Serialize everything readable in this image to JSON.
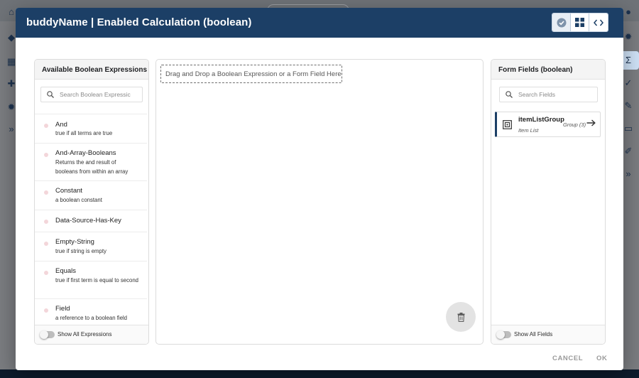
{
  "dialog": {
    "title": "buddyName | Enabled Calculation (boolean)"
  },
  "expressions_panel": {
    "header": "Available Boolean Expressions",
    "search_placeholder": "Search Boolean Expressic",
    "items": [
      {
        "name": "And",
        "desc": "true if all terms are true"
      },
      {
        "name": "And-Array-Booleans",
        "desc": "Returns the and result of booleans from within an array"
      },
      {
        "name": "Constant",
        "desc": "a boolean constant"
      },
      {
        "name": "Data-Source-Has-Key",
        "desc": ""
      },
      {
        "name": "Empty-String",
        "desc": "true if string is empty"
      },
      {
        "name": "Equals",
        "desc": "true if first term is equal to second"
      },
      {
        "name": "Field",
        "desc": "a reference to a boolean field"
      }
    ],
    "toggle_label": "Show All Expressions"
  },
  "canvas": {
    "drop_hint": "Drag and Drop a Boolean Expression or a Form Field Here"
  },
  "fields_panel": {
    "header": "Form Fields (boolean)",
    "search_placeholder": "Search Fields",
    "field": {
      "name": "itemListGroup",
      "type": "Item List",
      "group": "Group (3)"
    },
    "toggle_label": "Show All Fields"
  },
  "actions": {
    "cancel": "CANCEL",
    "ok": "OK"
  },
  "colors": {
    "header_bg": "#1c3f66",
    "accent": "#1c3f66",
    "expression_dot": "#f3d6da"
  },
  "icons": [
    "check-circle-icon",
    "grid-icon",
    "code-icon",
    "search-icon",
    "trash-icon",
    "group-field-icon",
    "arrow-right-icon"
  ]
}
